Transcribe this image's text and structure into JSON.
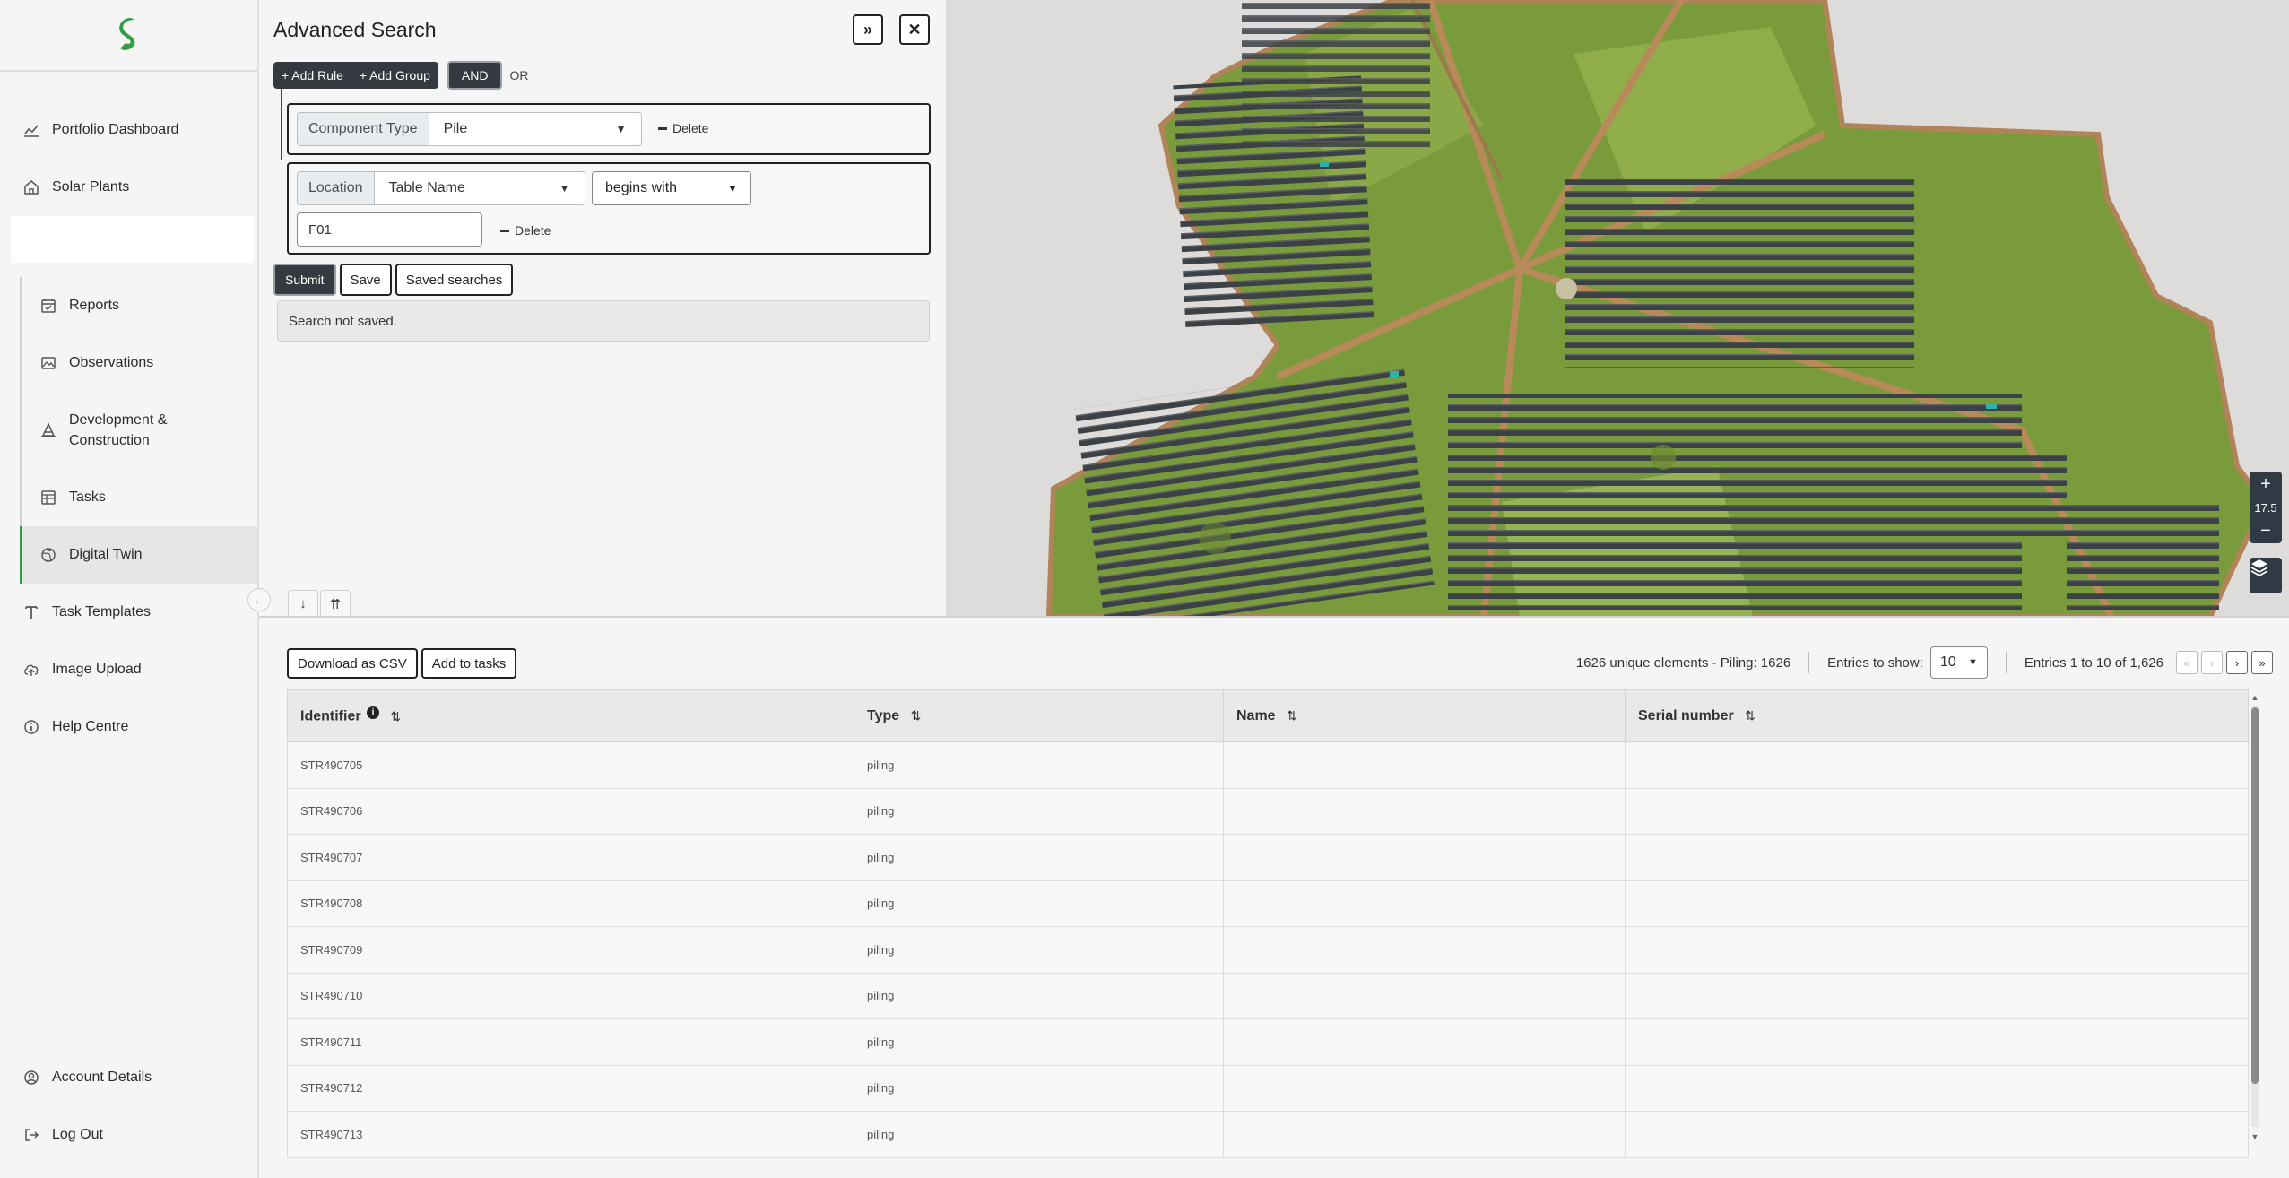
{
  "sidebar": {
    "logo_icon": "s-logo-icon",
    "items_top": [
      {
        "label": "Portfolio Dashboard",
        "icon": "chart-line-icon"
      },
      {
        "label": "Solar Plants",
        "icon": "house-icon"
      }
    ],
    "items_sub": [
      {
        "label": "Reports",
        "icon": "calendar-check-icon"
      },
      {
        "label": "Observations",
        "icon": "image-icon"
      },
      {
        "label": "Development & Construction",
        "icon": "cone-icon"
      },
      {
        "label": "Tasks",
        "icon": "table-icon"
      },
      {
        "label": "Digital Twin",
        "icon": "globe-icon"
      }
    ],
    "items_mid": [
      {
        "label": "Task Templates",
        "icon": "text-t-icon"
      },
      {
        "label": "Image Upload",
        "icon": "cloud-upload-icon"
      },
      {
        "label": "Help Centre",
        "icon": "info-circle-icon"
      }
    ],
    "items_bottom": [
      {
        "label": "Account Details",
        "icon": "user-circle-icon"
      },
      {
        "label": "Log Out",
        "icon": "logout-icon"
      }
    ]
  },
  "search": {
    "title": "Advanced Search",
    "expand_label": "»",
    "close_label": "✕",
    "add_rule": "+ Add Rule",
    "add_group": "+ Add Group",
    "and_label": "AND",
    "or_label": "OR",
    "rule1": {
      "label": "Component Type",
      "value": "Pile",
      "delete": "Delete"
    },
    "rule2": {
      "label": "Location",
      "field": "Table Name",
      "operator": "begins with",
      "value": "F01",
      "delete": "Delete"
    },
    "submit": "Submit",
    "save": "Save",
    "saved_searches": "Saved searches",
    "status": "Search not saved.",
    "tab_down": "↓",
    "tab_up": "⇈"
  },
  "map": {
    "zoom_in": "+",
    "zoom_level": "17.5",
    "zoom_out": "−",
    "layers_icon": "layers-icon"
  },
  "table": {
    "download_csv": "Download as CSV",
    "add_to_tasks": "Add to tasks",
    "summary": "1626 unique elements - Piling: 1626",
    "entries_label": "Entries to show:",
    "entries_value": "10",
    "range": "Entries 1 to 10 of 1,626",
    "pager": [
      "«",
      "‹",
      "›",
      "»"
    ],
    "columns": [
      "Identifier",
      "Type",
      "Name",
      "Serial number"
    ],
    "rows": [
      {
        "id": "STR490705",
        "type": "piling",
        "name": "",
        "serial": ""
      },
      {
        "id": "STR490706",
        "type": "piling",
        "name": "",
        "serial": ""
      },
      {
        "id": "STR490707",
        "type": "piling",
        "name": "",
        "serial": ""
      },
      {
        "id": "STR490708",
        "type": "piling",
        "name": "",
        "serial": ""
      },
      {
        "id": "STR490709",
        "type": "piling",
        "name": "",
        "serial": ""
      },
      {
        "id": "STR490710",
        "type": "piling",
        "name": "",
        "serial": ""
      },
      {
        "id": "STR490711",
        "type": "piling",
        "name": "",
        "serial": ""
      },
      {
        "id": "STR490712",
        "type": "piling",
        "name": "",
        "serial": ""
      },
      {
        "id": "STR490713",
        "type": "piling",
        "name": "",
        "serial": ""
      }
    ]
  },
  "colors": {
    "brand_green": "#2ea043",
    "dark_button": "#343a40",
    "map_grass": "#7a9b3c"
  }
}
